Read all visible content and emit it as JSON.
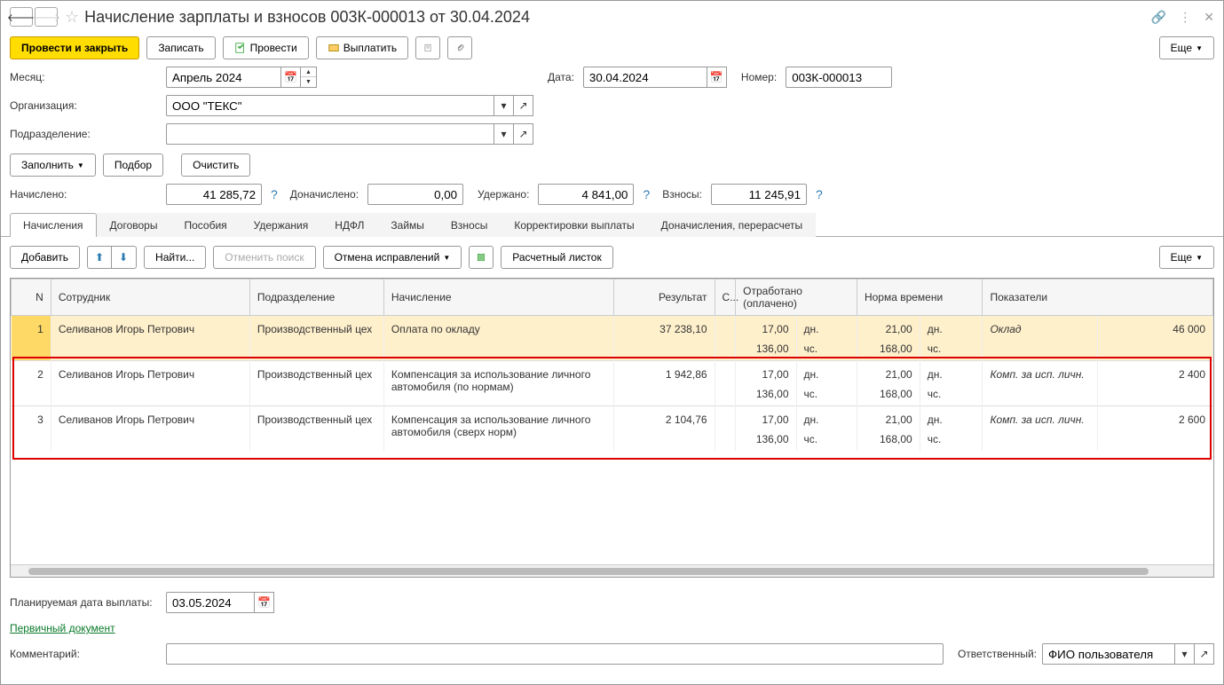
{
  "title": "Начисление зарплаты и взносов 003К-000013 от 30.04.2024",
  "toolbar": {
    "post_close": "Провести и закрыть",
    "save": "Записать",
    "post": "Провести",
    "pay": "Выплатить",
    "more": "Еще"
  },
  "form": {
    "month_label": "Месяц:",
    "month_value": "Апрель 2024",
    "date_label": "Дата:",
    "date_value": "30.04.2024",
    "number_label": "Номер:",
    "number_value": "003К-000013",
    "org_label": "Организация:",
    "org_value": "ООО \"ТЕКС\"",
    "dept_label": "Подразделение:",
    "dept_value": ""
  },
  "actions": {
    "fill": "Заполнить",
    "pick": "Подбор",
    "clear": "Очистить"
  },
  "totals": {
    "accrued_label": "Начислено:",
    "accrued_value": "41 285,72",
    "addl_label": "Доначислено:",
    "addl_value": "0,00",
    "withheld_label": "Удержано:",
    "withheld_value": "4 841,00",
    "contrib_label": "Взносы:",
    "contrib_value": "11 245,91"
  },
  "tabs": [
    "Начисления",
    "Договоры",
    "Пособия",
    "Удержания",
    "НДФЛ",
    "Займы",
    "Взносы",
    "Корректировки выплаты",
    "Доначисления, перерасчеты"
  ],
  "table_toolbar": {
    "add": "Добавить",
    "find": "Найти...",
    "cancel_find": "Отменить поиск",
    "cancel_fix": "Отмена исправлений",
    "payslip": "Расчетный листок",
    "more": "Еще"
  },
  "columns": {
    "n": "N",
    "emp": "Сотрудник",
    "dept": "Подразделение",
    "acc": "Начисление",
    "res": "Результат",
    "s": "С...",
    "worked": "Отработано (оплачено)",
    "norm": "Норма времени",
    "ind": "Показатели"
  },
  "units": {
    "days": "дн.",
    "hours": "чс."
  },
  "rows": [
    {
      "n": "1",
      "emp": "Селиванов Игорь Петрович",
      "dept": "Производственный цех",
      "acc": "Оплата по окладу",
      "res": "37 238,10",
      "w_days": "17,00",
      "w_hours": "136,00",
      "n_days": "21,00",
      "n_hours": "168,00",
      "ind": "Оклад",
      "ind_val": "46 000"
    },
    {
      "n": "2",
      "emp": "Селиванов Игорь Петрович",
      "dept": "Производственный цех",
      "acc": "Компенсация за использование личного автомобиля (по нормам)",
      "res": "1 942,86",
      "w_days": "17,00",
      "w_hours": "136,00",
      "n_days": "21,00",
      "n_hours": "168,00",
      "ind": "Комп. за исп. личн.",
      "ind_val": "2 400"
    },
    {
      "n": "3",
      "emp": "Селиванов Игорь Петрович",
      "dept": "Производственный цех",
      "acc": "Компенсация за использование личного автомобиля (сверх норм)",
      "res": "2 104,76",
      "w_days": "17,00",
      "w_hours": "136,00",
      "n_days": "21,00",
      "n_hours": "168,00",
      "ind": "Комп. за исп. личн.",
      "ind_val": "2 600"
    }
  ],
  "bottom": {
    "plan_date_label": "Планируемая дата выплаты:",
    "plan_date_value": "03.05.2024",
    "primary_doc": "Первичный документ",
    "comment_label": "Комментарий:",
    "comment_value": "",
    "resp_label": "Ответственный:",
    "resp_value": "ФИО пользователя"
  }
}
